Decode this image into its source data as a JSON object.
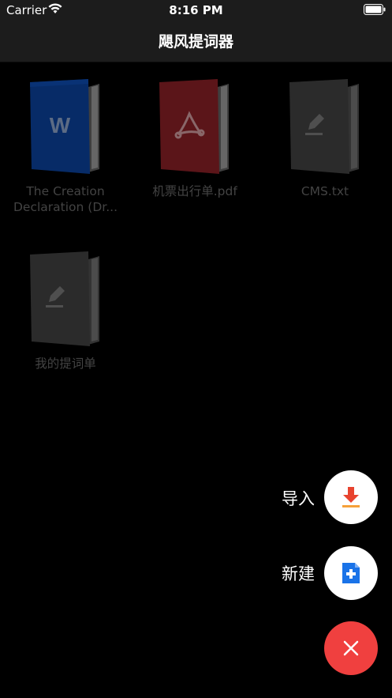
{
  "status_bar": {
    "carrier": "Carrier",
    "time": "8:16 PM"
  },
  "nav": {
    "title": "飓风提词器"
  },
  "files": [
    {
      "name": "The Creation Declaration (Dr...",
      "type": "word",
      "icon": "word-icon",
      "color": "#0a3a8a"
    },
    {
      "name": "机票出行单.pdf",
      "type": "pdf",
      "icon": "pdf-icon",
      "color": "#7a1c22"
    },
    {
      "name": "CMS.txt",
      "type": "txt",
      "icon": "edit-icon",
      "color": "#3a3a3a"
    },
    {
      "name": "我的提词单",
      "type": "txt",
      "icon": "edit-icon",
      "color": "#3a3a3a"
    }
  ],
  "actions": {
    "import_label": "导入",
    "new_label": "新建"
  },
  "colors": {
    "accent_red": "#f0403f",
    "import_icon": "#e8432f",
    "new_icon": "#1a73e8"
  }
}
